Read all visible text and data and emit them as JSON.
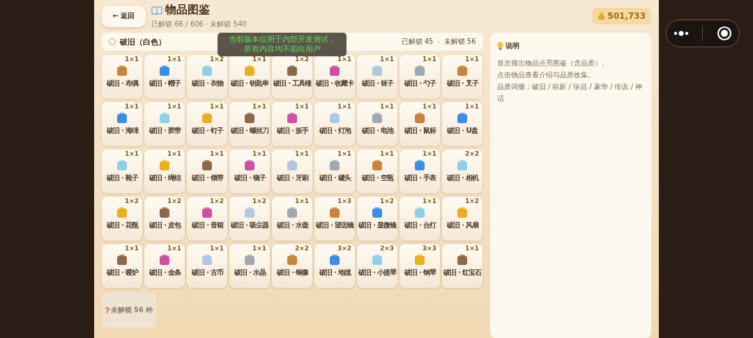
{
  "header": {
    "back_button": "← 返回",
    "title": "物品图鉴",
    "subtitle": "已解锁 66 / 606 · 未解锁 540",
    "coins": "501,733"
  },
  "quality_bar": {
    "name": "破旧（白色）",
    "selected": false,
    "unlocked": "已解锁 45",
    "separator": "·",
    "locked": "未解锁 56"
  },
  "toast": [
    "当前版本仅用于内部开发测试，",
    "所有内容均不面向用户"
  ],
  "items": [
    {
      "size": "1×1",
      "name": "破旧・布偶"
    },
    {
      "size": "1×1",
      "name": "破旧・帽子"
    },
    {
      "size": "1×2",
      "name": "破旧・衣物"
    },
    {
      "size": "1×1",
      "name": "破旧・钥匙串"
    },
    {
      "size": "1×2",
      "name": "破旧・工具锤"
    },
    {
      "size": "1×1",
      "name": "破旧・收藏卡"
    },
    {
      "size": "1×1",
      "name": "破旧・袜子"
    },
    {
      "size": "1×1",
      "name": "破旧・勺子"
    },
    {
      "size": "1×1",
      "name": "破旧・叉子"
    },
    {
      "size": "1×1",
      "name": "破旧・海绵"
    },
    {
      "size": "1×1",
      "name": "破旧・胶带"
    },
    {
      "size": "1×1",
      "name": "破旧・钉子"
    },
    {
      "size": "1×1",
      "name": "破旧・螺丝刀"
    },
    {
      "size": "1×1",
      "name": "破旧・扳手"
    },
    {
      "size": "1×1",
      "name": "破旧・灯泡"
    },
    {
      "size": "1×1",
      "name": "破旧・电池"
    },
    {
      "size": "1×1",
      "name": "破旧・鼠标"
    },
    {
      "size": "1×1",
      "name": "破旧・U盘"
    },
    {
      "size": "1×1",
      "name": "破旧・靴子"
    },
    {
      "size": "1×1",
      "name": "破旧・绳结"
    },
    {
      "size": "1×1",
      "name": "破旧・领带"
    },
    {
      "size": "1×1",
      "name": "破旧・镜子"
    },
    {
      "size": "1×1",
      "name": "破旧・牙刷"
    },
    {
      "size": "1×1",
      "name": "破旧・罐头"
    },
    {
      "size": "1×1",
      "name": "破旧・空瓶"
    },
    {
      "size": "1×1",
      "name": "破旧・手表"
    },
    {
      "size": "2×2",
      "name": "破旧・相机"
    },
    {
      "size": "1×2",
      "name": "破旧・花瓶"
    },
    {
      "size": "1×2",
      "name": "破旧・皮包"
    },
    {
      "size": "1×2",
      "name": "破旧・音箱"
    },
    {
      "size": "1×2",
      "name": "破旧・吸尘器"
    },
    {
      "size": "1×1",
      "name": "破旧・水壶"
    },
    {
      "size": "1×3",
      "name": "破旧・望远镜"
    },
    {
      "size": "1×2",
      "name": "破旧・显微镜"
    },
    {
      "size": "1×1",
      "name": "破旧・台灯"
    },
    {
      "size": "1×2",
      "name": "破旧・风扇"
    },
    {
      "size": "1×1",
      "name": "破旧・暖炉"
    },
    {
      "size": "1×1",
      "name": "破旧・金条"
    },
    {
      "size": "1×1",
      "name": "破旧・古币"
    },
    {
      "size": "1×1",
      "name": "破旧・水晶"
    },
    {
      "size": "2×2",
      "name": "破旧・铜像"
    },
    {
      "size": "3×2",
      "name": "破旧・地毯"
    },
    {
      "size": "2×3",
      "name": "破旧・小提琴"
    },
    {
      "size": "3×3",
      "name": "破旧・钢琴"
    },
    {
      "size": "1×1",
      "name": "破旧・红宝石"
    }
  ],
  "locked_tile": "未解锁 56 种",
  "info": {
    "title": "说明",
    "lines": [
      "首次搜出物品点亮图鉴（含品质）。",
      "点击物品查看介绍与品质收集。",
      "品质词缀：破旧 / 崭新 / 珍品 / 豪华 / 传说 / 神话"
    ]
  }
}
